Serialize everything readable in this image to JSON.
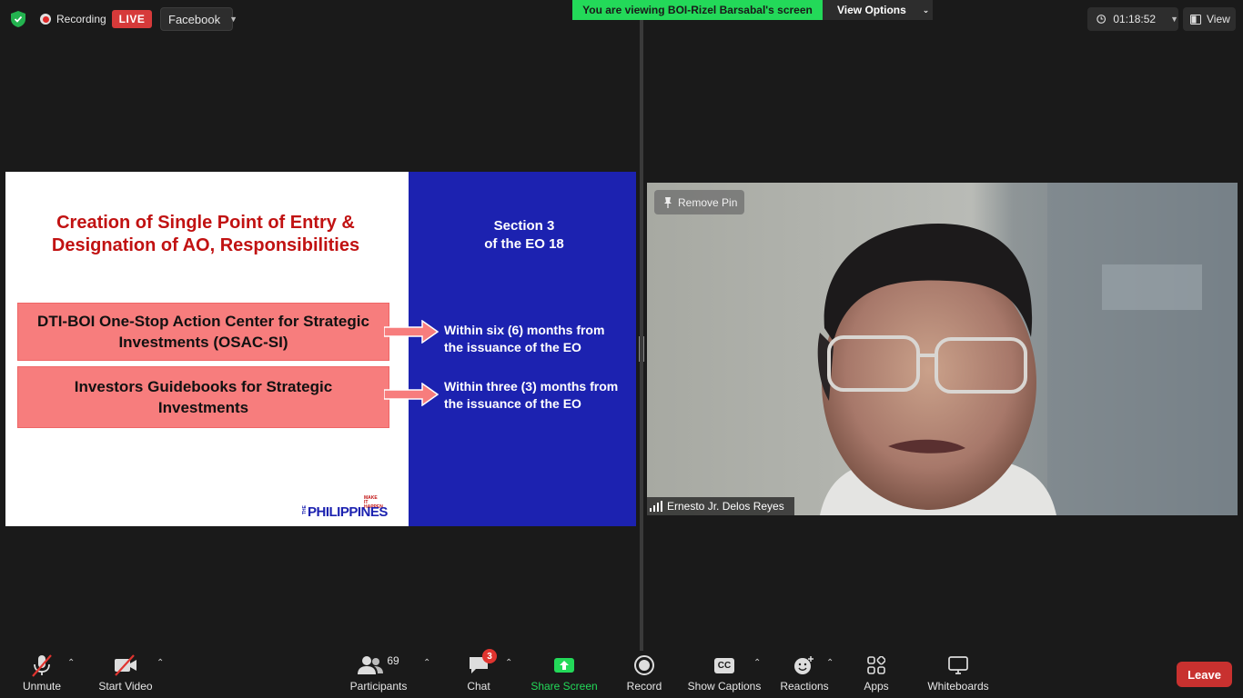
{
  "topbar": {
    "recording_label": "Recording",
    "live_label": "LIVE",
    "stream_target": "Facebook",
    "viewing_banner": "You are viewing BOI-Rizel Barsabal's screen",
    "view_options_label": "View Options",
    "timer": "01:18:52",
    "view_label": "View"
  },
  "slide": {
    "title_line1": "Creation of Single Point of Entry &",
    "title_line2": "Designation of AO, Responsibilities",
    "box1_line1": "DTI-BOI One-Stop Action Center for Strategic",
    "box1_line2": "Investments (OSAC-SI)",
    "box2_line1": "Investors Guidebooks for Strategic",
    "box2_line2": "Investments",
    "section_line1": "Section 3",
    "section_line2": "of the EO 18",
    "timeline1_line1": "Within six (6) months from",
    "timeline1_line2": "the issuance of the EO",
    "timeline2_line1": "Within three (3) months from",
    "timeline2_line2": "the issuance of the EO",
    "logo_text": "PHILIPPINES",
    "logo_small": "MAKE IT HAPPEN"
  },
  "video": {
    "remove_pin_label": "Remove Pin",
    "participant_name": "Ernesto Jr. Delos Reyes"
  },
  "toolbar": {
    "unmute": "Unmute",
    "start_video": "Start Video",
    "participants": "Participants",
    "participants_count": "69",
    "chat": "Chat",
    "chat_badge": "3",
    "share_screen": "Share Screen",
    "record": "Record",
    "captions_icon_text": "CC",
    "show_captions": "Show Captions",
    "reactions": "Reactions",
    "apps": "Apps",
    "whiteboards": "Whiteboards",
    "leave": "Leave"
  },
  "colors": {
    "share_green": "#23d959",
    "live_red": "#d63a3a",
    "slide_blue": "#1c22b0",
    "box_salmon": "#f77d7d",
    "title_red": "#c11212"
  }
}
